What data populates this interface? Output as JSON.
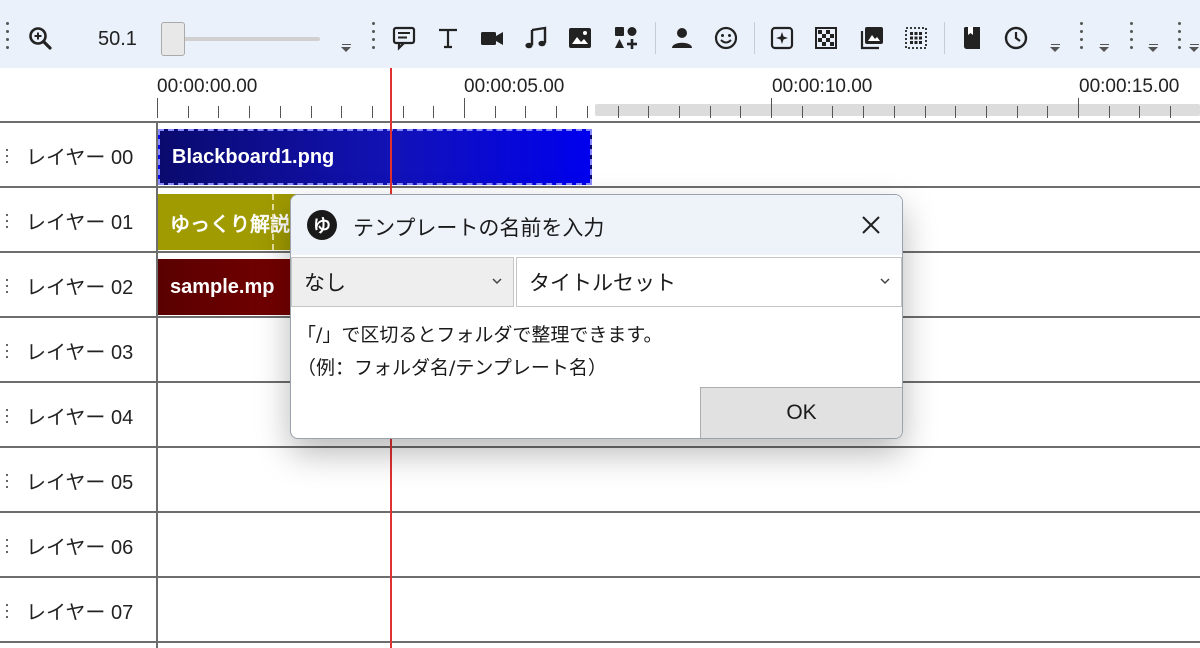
{
  "toolbar": {
    "zoom_value": "50.1",
    "icons": [
      "zoom-icon",
      "comment-icon",
      "text-icon",
      "video-icon",
      "music-icon",
      "image-icon",
      "shapes-add-icon",
      "person-icon",
      "smiley-icon",
      "effect-add-icon",
      "pattern-icon",
      "image-layers-icon",
      "grid-icon",
      "bookmark-icon",
      "clock-icon"
    ]
  },
  "ruler": {
    "labels": [
      "00:00:00.00",
      "00:00:05.00",
      "00:00:10.00",
      "00:00:15.00"
    ]
  },
  "layers": [
    {
      "name": "レイヤー 00"
    },
    {
      "name": "レイヤー 01"
    },
    {
      "name": "レイヤー 02"
    },
    {
      "name": "レイヤー 03"
    },
    {
      "name": "レイヤー 04"
    },
    {
      "name": "レイヤー 05"
    },
    {
      "name": "レイヤー 06"
    },
    {
      "name": "レイヤー 07"
    }
  ],
  "clips": [
    {
      "label": "Blackboard1.png",
      "color": "#1212b8"
    },
    {
      "label": "ゆっくり解説",
      "color": "#a09b00"
    },
    {
      "label": "sample.mp",
      "color": "#6a0000"
    }
  ],
  "dialog": {
    "app_icon": "ゆ",
    "title": "テンプレートの名前を入力",
    "combo_left": "なし",
    "combo_right": "タイトルセット",
    "hint_line1": "「/」で区切るとフォルダで整理できます。",
    "hint_line2": "（例：フォルダ名/テンプレート名）",
    "ok_label": "OK"
  },
  "colors": {
    "toolbar_bg": "#eaf1fb",
    "playhead": "#e03030",
    "dialog_title_bg": "#eef3fa"
  }
}
